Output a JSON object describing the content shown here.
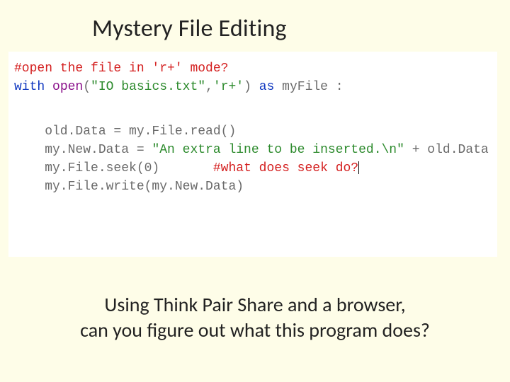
{
  "title": "Mystery File Editing",
  "code": {
    "comment1": "#open the file in 'r+' mode?",
    "with": "with",
    "open_fn": "open",
    "paren_open": "(",
    "filename": "\"IO basics.txt\"",
    "comma": ",",
    "mode": "'r+'",
    "paren_close": ")",
    "as": "as",
    "varfile": " myFile :",
    "line3": "    old.Data = my.File.read()",
    "line4a": "    my.New.Data = ",
    "line4b": "\"An extra line to be inserted.\\n\"",
    "line4c": " + old.Data",
    "line5a": "    my.File.seek(0)       ",
    "line5b": "#what does seek do?",
    "line6": "    my.File.write(my.New.Data)"
  },
  "footer_line1": "Using Think Pair Share and a browser,",
  "footer_line2": "can you figure out what this program does?"
}
